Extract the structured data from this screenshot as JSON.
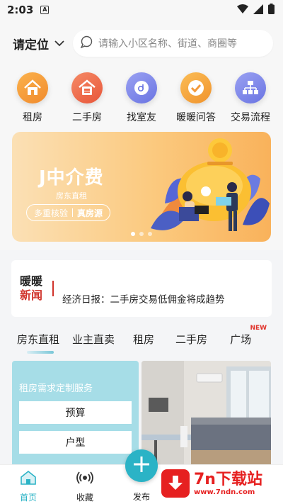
{
  "status": {
    "time": "2:03",
    "notif_icon": "A"
  },
  "header": {
    "location_label": "请定位",
    "search_placeholder": "请输入小区名称、街道、商圈等"
  },
  "categories": [
    {
      "label": "租房",
      "icon": "house-icon",
      "color": "#f39a3b"
    },
    {
      "label": "二手房",
      "icon": "second-hand-house-icon",
      "color": "#ee6b4a"
    },
    {
      "label": "找室友",
      "icon": "roommate-icon",
      "color": "#7c86ea"
    },
    {
      "label": "暖暖问答",
      "icon": "checkmark-icon",
      "color": "#f5a340"
    },
    {
      "label": "交易流程",
      "icon": "flowchart-icon",
      "color": "#7c86ea"
    }
  ],
  "banner": {
    "title": "J中介费",
    "subtitle": "房东直租",
    "pill_left": "多重核验",
    "pill_right": "真房源",
    "page_count": 3,
    "active_page": 1
  },
  "news": {
    "tag_top": "暖暖",
    "tag_bottom": "新闻",
    "text": "经济日报：二手房交易低佣金将成趋势"
  },
  "tabs": [
    {
      "label": "房东直租",
      "active": true
    },
    {
      "label": "业主直卖",
      "active": false
    },
    {
      "label": "租房",
      "active": false
    },
    {
      "label": "二手房",
      "active": false
    },
    {
      "label": "广场",
      "active": false,
      "badge": "NEW"
    }
  ],
  "service_card": {
    "title": "租房需求定制服务",
    "options": [
      "预算",
      "户型"
    ]
  },
  "bottom_nav": [
    {
      "label": "首页",
      "icon": "home-icon",
      "active": true
    },
    {
      "label": "收藏",
      "icon": "radio-waves-icon",
      "active": false
    },
    {
      "label": "发布",
      "icon": "plus-icon",
      "active": false
    }
  ],
  "watermark": {
    "title": "7n下载站",
    "url": "www.7ndn.com"
  }
}
